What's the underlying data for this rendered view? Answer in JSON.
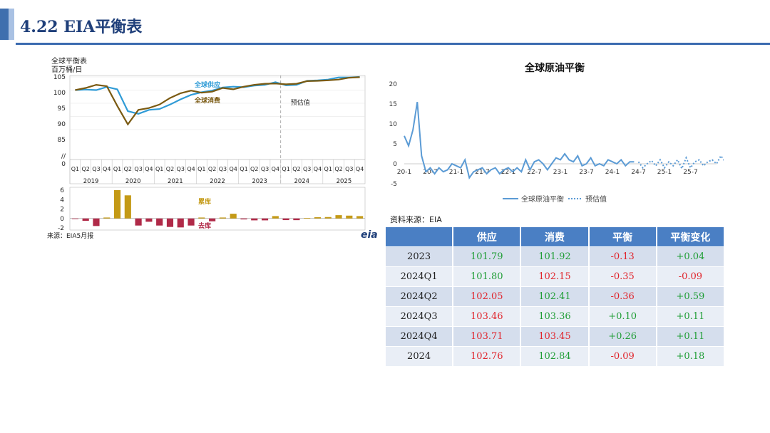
{
  "header": {
    "title": "4.22 EIA平衡表"
  },
  "left_chart": {
    "title": "全球平衡表",
    "unit": "百万桶/日",
    "source": "来源：EIA5月报",
    "forecast_label": "预估值",
    "labels": {
      "supply": "全球供应",
      "demand": "全球消费",
      "build": "累库",
      "draw": "去库"
    },
    "logo": "eia",
    "y_ticks": [
      "105",
      "100",
      "95",
      "90",
      "85",
      "//",
      "0"
    ],
    "bar_ticks": [
      "6",
      "4",
      "2",
      "0",
      "-2"
    ],
    "quarters": [
      "Q1",
      "Q2",
      "Q3",
      "Q4",
      "Q1",
      "Q2",
      "Q3",
      "Q4",
      "Q1",
      "Q2",
      "Q3",
      "Q4",
      "Q1",
      "Q2",
      "Q3",
      "Q4",
      "Q1",
      "Q2",
      "Q3",
      "Q4",
      "Q1",
      "Q2",
      "Q3",
      "Q4",
      "Q1",
      "Q2",
      "Q3",
      "Q4"
    ],
    "years": [
      "2019",
      "2020",
      "2021",
      "2022",
      "2023",
      "2024",
      "2025"
    ]
  },
  "right_chart": {
    "title": "全球原油平衡",
    "y_ticks": [
      "20",
      "15",
      "10",
      "5",
      "0",
      "-5"
    ],
    "x_ticks": [
      "20-1",
      "20-7",
      "21-1",
      "21-7",
      "22-1",
      "22-7",
      "23-1",
      "23-7",
      "24-1",
      "24-7",
      "25-1",
      "25-7"
    ],
    "legend": {
      "actual": "全球原油平衡",
      "forecast": "预估值"
    }
  },
  "source_note": "资料来源：EIA",
  "table": {
    "headers": [
      "",
      "供应",
      "消费",
      "平衡",
      "平衡变化"
    ],
    "rows": [
      {
        "period": "2023",
        "supply": "101.79",
        "demand": "101.92",
        "balance": "-0.13",
        "change": "+0.04"
      },
      {
        "period": "2024Q1",
        "supply": "101.80",
        "demand": "102.15",
        "balance": "-0.35",
        "change": "-0.09"
      },
      {
        "period": "2024Q2",
        "supply": "102.05",
        "demand": "102.41",
        "balance": "-0.36",
        "change": "+0.59"
      },
      {
        "period": "2024Q3",
        "supply": "103.46",
        "demand": "103.36",
        "balance": "+0.10",
        "change": "+0.11"
      },
      {
        "period": "2024Q4",
        "supply": "103.71",
        "demand": "103.45",
        "balance": "+0.26",
        "change": "+0.11"
      },
      {
        "period": "2024",
        "supply": "102.76",
        "demand": "102.84",
        "balance": "-0.09",
        "change": "+0.18"
      }
    ],
    "colors": {
      "supply": [
        "green",
        "green",
        "red",
        "red",
        "red",
        "red"
      ],
      "demand": [
        "green",
        "red",
        "green",
        "green",
        "red",
        "green"
      ],
      "balance": [
        "red",
        "red",
        "red",
        "green",
        "green",
        "red"
      ],
      "change": [
        "green",
        "red",
        "green",
        "green",
        "green",
        "green"
      ]
    }
  },
  "colors": {
    "supply": "#2f9bd6",
    "demand": "#7a5a12",
    "build": "#c49a16",
    "draw": "#b02a48",
    "line": "#5b9bd5",
    "header_blue": "#4a7fc4"
  },
  "chart_data": [
    {
      "type": "line",
      "title": "全球平衡表",
      "ylabel": "百万桶/日",
      "x": [
        "2019Q1",
        "2019Q2",
        "2019Q3",
        "2019Q4",
        "2020Q1",
        "2020Q2",
        "2020Q3",
        "2020Q4",
        "2021Q1",
        "2021Q2",
        "2021Q3",
        "2021Q4",
        "2022Q1",
        "2022Q2",
        "2022Q3",
        "2022Q4",
        "2023Q1",
        "2023Q2",
        "2023Q3",
        "2023Q4",
        "2024Q1",
        "2024Q2",
        "2024Q3",
        "2024Q4",
        "2025Q1",
        "2025Q2",
        "2025Q3",
        "2025Q4"
      ],
      "ylim": [
        85,
        105
      ],
      "forecast_start": "2024Q1",
      "series": [
        {
          "name": "全球供应",
          "values": [
            100.0,
            100.2,
            100.0,
            101.2,
            100.3,
            92.0,
            91.0,
            92.5,
            92.8,
            94.5,
            96.5,
            98.2,
            99.2,
            99.8,
            101.0,
            101.3,
            101.1,
            101.7,
            102.0,
            103.0,
            101.8,
            102.0,
            103.5,
            103.7,
            104.0,
            104.8,
            104.8,
            105.0
          ]
        },
        {
          "name": "全球消费",
          "values": [
            100.0,
            100.8,
            102.0,
            101.5,
            94.0,
            87.0,
            92.5,
            93.2,
            94.5,
            97.0,
            98.8,
            99.8,
            99.0,
            99.4,
            100.8,
            100.3,
            101.3,
            102.0,
            102.4,
            102.5,
            102.2,
            102.4,
            103.4,
            103.5,
            103.7,
            104.0,
            104.7,
            104.9
          ]
        }
      ]
    },
    {
      "type": "bar",
      "title": "",
      "x": [
        "2019Q1",
        "2019Q2",
        "2019Q3",
        "2019Q4",
        "2020Q1",
        "2020Q2",
        "2020Q3",
        "2020Q4",
        "2021Q1",
        "2021Q2",
        "2021Q3",
        "2021Q4",
        "2022Q1",
        "2022Q2",
        "2022Q3",
        "2022Q4",
        "2023Q1",
        "2023Q2",
        "2023Q3",
        "2023Q4",
        "2024Q1",
        "2024Q2",
        "2024Q3",
        "2024Q4",
        "2025Q1",
        "2025Q2",
        "2025Q3",
        "2025Q4"
      ],
      "ylim": [
        -2,
        6
      ],
      "series": [
        {
          "name": "累库/去库",
          "values": [
            -0.1,
            -0.5,
            -1.6,
            0.2,
            6.0,
            4.9,
            -1.5,
            -0.7,
            -1.5,
            -1.8,
            -1.9,
            -1.5,
            0.2,
            -0.6,
            0.2,
            1.0,
            -0.2,
            -0.4,
            -0.4,
            0.5,
            -0.35,
            -0.36,
            0.1,
            0.26,
            0.3,
            0.7,
            0.6,
            0.5
          ]
        }
      ]
    },
    {
      "type": "line",
      "title": "全球原油平衡",
      "xlabel": "",
      "ylabel": "",
      "ylim": [
        -5,
        20
      ],
      "x_ticks": [
        "20-1",
        "20-7",
        "21-1",
        "21-7",
        "22-1",
        "22-7",
        "23-1",
        "23-7",
        "24-1",
        "24-7",
        "25-1",
        "25-7"
      ],
      "series": [
        {
          "name": "全球原油平衡",
          "start": "2020-01",
          "values": [
            7,
            4.5,
            8.5,
            15.5,
            2,
            -2,
            -1,
            -2.5,
            -1,
            -2,
            -1.5,
            0,
            -0.5,
            -1,
            1,
            -3.5,
            -2,
            -1.5,
            -1,
            -2.5,
            -1.5,
            -1,
            -2.5,
            -1.5,
            -1,
            -2,
            -1,
            -2,
            1,
            -1.5,
            0.5,
            1,
            0,
            -1.5,
            0,
            1.5,
            1,
            2.5,
            1,
            0.5,
            2,
            -0.5,
            0,
            1.5,
            -0.5,
            0,
            -0.5,
            1,
            0.5,
            0,
            1,
            -0.5,
            0.5,
            0.5
          ]
        },
        {
          "name": "预估值",
          "start": "2024-07",
          "values": [
            0.5,
            -1,
            0,
            0.8,
            -0.5,
            1,
            -1,
            0.5,
            -0.5,
            1,
            -1.2,
            1.5,
            -1,
            0.5,
            1,
            -0.5,
            0.5,
            1,
            0,
            2,
            0.5,
            0,
            -1
          ]
        }
      ]
    }
  ]
}
